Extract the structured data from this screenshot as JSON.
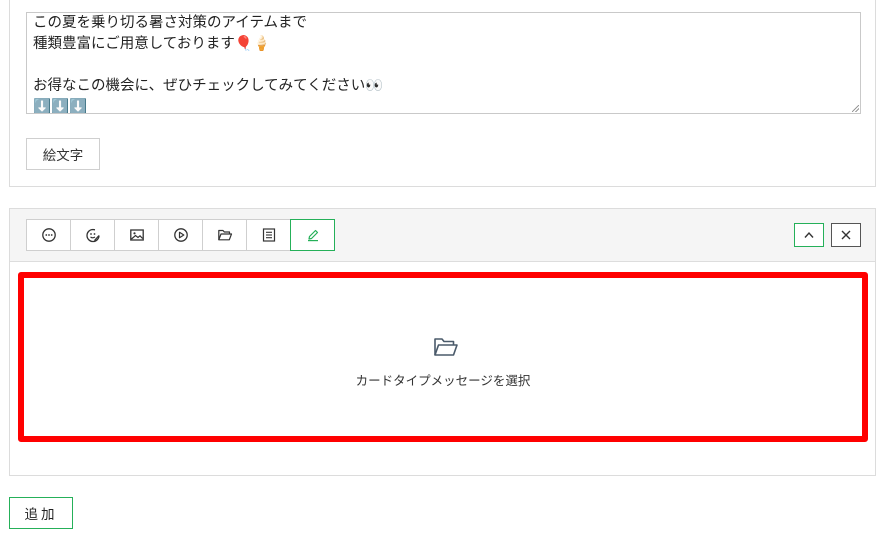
{
  "message": {
    "lines": [
      "この夏を乗り切る暑さ対策のアイテムまで",
      "種類豊富にご用意しております🎈🍦",
      "",
      "お得なこの機会に、ぜひチェックしてみてください👀",
      "⬇️⬇️⬇️"
    ],
    "emoji_button_label": "絵文字"
  },
  "toolbar": {
    "tools": [
      {
        "icon": "chat-bubble-icon"
      },
      {
        "icon": "sticker-icon"
      },
      {
        "icon": "image-icon"
      },
      {
        "icon": "video-play-icon"
      },
      {
        "icon": "folder-open-icon"
      },
      {
        "icon": "list-document-icon"
      },
      {
        "icon": "pencil-icon",
        "active": true
      }
    ],
    "controls": [
      {
        "icon": "chevron-up-icon"
      },
      {
        "icon": "close-icon"
      }
    ]
  },
  "dropzone": {
    "icon": "folder-open-icon",
    "label": "カードタイプメッセージを選択"
  },
  "add_button_label": "追加",
  "colors": {
    "accent_green": "#25b059",
    "highlight_red": "#ff0000",
    "toolbar_bg": "#f5f5f5",
    "border": "#dcdcdc"
  }
}
